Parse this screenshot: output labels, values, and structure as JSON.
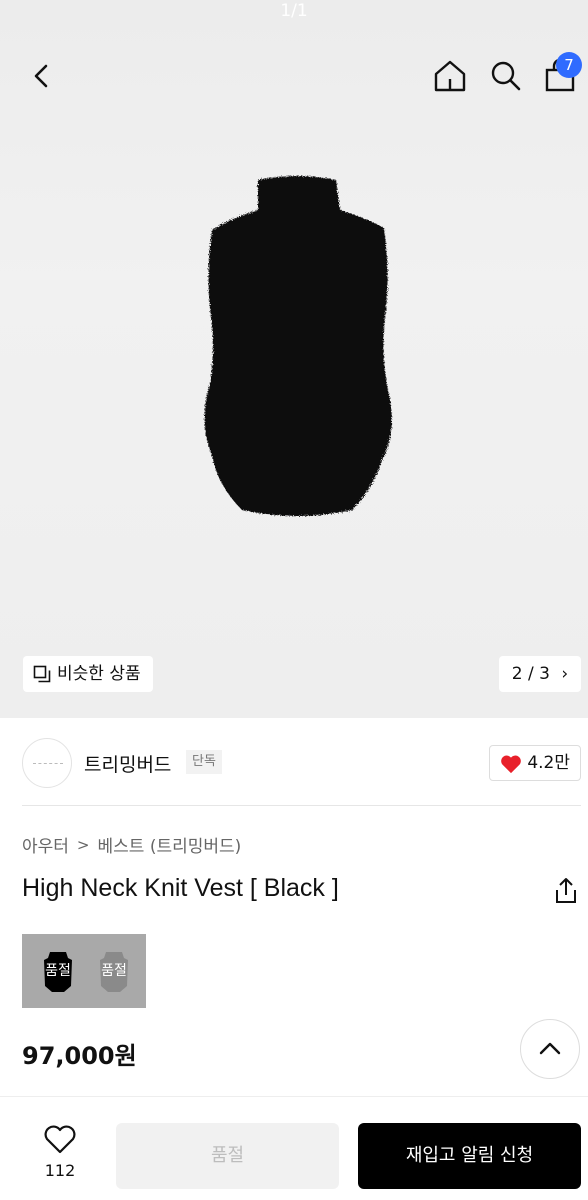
{
  "gallery": {
    "counter": "1/1",
    "similar_label": "비슷한 상품",
    "pager_text": "2 / 3",
    "pager_arrow": "›"
  },
  "header": {
    "icons": [
      "back-icon",
      "home-icon",
      "search-icon",
      "bag-icon"
    ],
    "cart_count": "7"
  },
  "brand": {
    "name": "트리밍버드",
    "badge": "단독",
    "likes": "4.2만"
  },
  "product": {
    "breadcrumb": [
      "아우터",
      "베스트 (트리밍버드)"
    ],
    "breadcrumb_sep": ">",
    "title": "High Neck Knit Vest [ Black ]",
    "swatches": [
      {
        "label": "품절",
        "color": "#000000"
      },
      {
        "label": "품절",
        "color": "#8a8a8a"
      }
    ],
    "price": "97,000원"
  },
  "bottom_bar": {
    "wish_count": "112",
    "soldout_label": "품절",
    "restock_label": "재입고 알림 신청"
  },
  "colors": {
    "badge_blue": "#2f6bff",
    "heart_red": "#e8202a",
    "primary_button": "#000000",
    "disabled_button": "#f1f1f1"
  }
}
